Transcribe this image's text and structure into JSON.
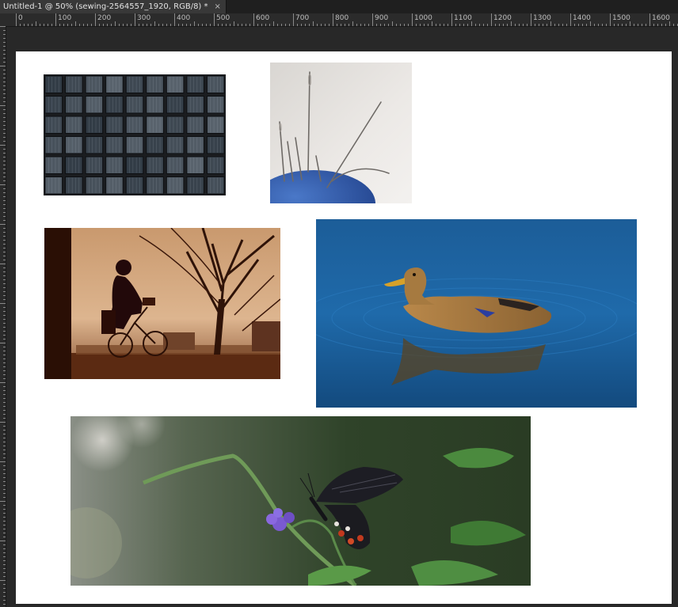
{
  "document_tab": {
    "title": "Untitled-1 @ 50% (sewing-2564557_1920, RGB/8) *",
    "close_glyph": "×"
  },
  "ruler": {
    "top_labels": [
      "0",
      "100",
      "200",
      "300",
      "400",
      "500",
      "600",
      "700",
      "800",
      "900",
      "1000",
      "1100",
      "1200",
      "1300",
      "1400",
      "1500",
      "1600"
    ]
  },
  "colors": {
    "workspace": "#282828",
    "document": "#ffffff",
    "ruler": "#2b2b2b"
  },
  "canvas": {
    "images": [
      {
        "name": "glass-blocks-photo",
        "subject": "glass block wall"
      },
      {
        "name": "sewing-needles-photo",
        "subject": "sewing needles in blue pincushion"
      },
      {
        "name": "cyclist-photo",
        "subject": "cyclist silhouette under bare trees in sepia"
      },
      {
        "name": "duck-photo",
        "subject": "mallard duck swimming on blue water"
      },
      {
        "name": "butterfly-photo",
        "subject": "black butterfly on purple flower"
      }
    ]
  }
}
